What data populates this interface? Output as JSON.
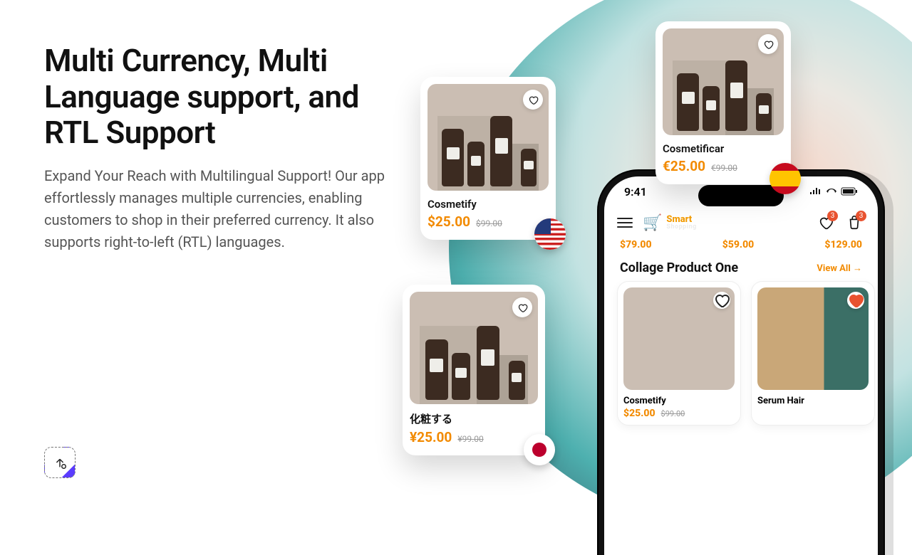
{
  "headline": "Multi Currency, Multi Language support, and RTL Support",
  "body": "Expand Your Reach with Multilingual Support! Our app effortlessly manages multiple currencies, enabling customers to shop in their preferred currency. It also supports right-to-left (RTL) languages.",
  "cards": {
    "us": {
      "title": "Cosmetify",
      "price": "$25.00",
      "oldprice": "$99.00",
      "flag": "us"
    },
    "es": {
      "title": "Cosmetificar",
      "price": "€25.00",
      "oldprice": "€99.00",
      "flag": "es"
    },
    "jp": {
      "title": "化粧する",
      "price": "¥25.00",
      "oldprice": "¥99.00",
      "flag": "jp"
    }
  },
  "phone": {
    "time": "9:41",
    "brand1": "Smart",
    "brand2": "Shopping",
    "wishlist_badge": "3",
    "cart_badge": "3",
    "top_prices": [
      "$79.00",
      "$59.00",
      "$129.00"
    ],
    "section_title": "Collage Product One",
    "viewall": "View All →",
    "products": [
      {
        "title": "Cosmetify",
        "price": "$25.00",
        "old": "$99.00"
      },
      {
        "title": "Serum Hair",
        "price": "",
        "old": ""
      }
    ]
  }
}
